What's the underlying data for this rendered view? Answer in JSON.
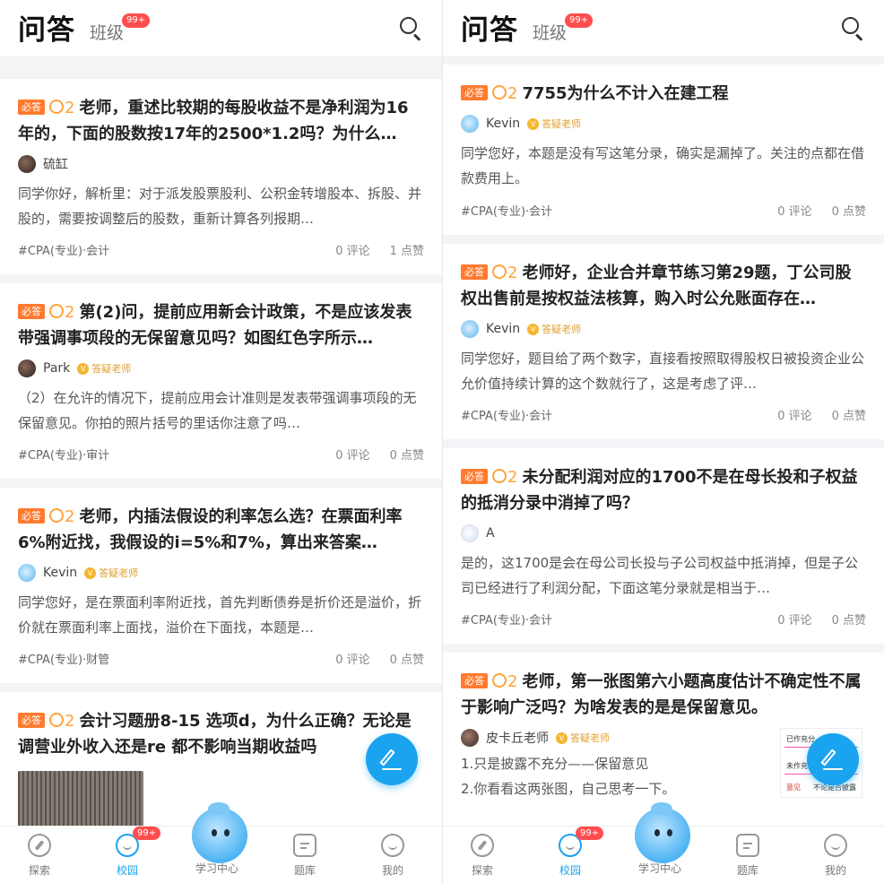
{
  "panes": [
    {
      "header": {
        "title": "问答",
        "subtitle": "班级",
        "badge": "99+"
      },
      "cards": [
        {
          "tag": "必答",
          "coins": "2",
          "question": "老师，重述比较期的每股收益不是净利润为16年的，下面的股数按17年的2500*1.2吗？为什么…",
          "author": "硫缸",
          "role": "",
          "answer": "同学你好，解析里：对于派发股票股利、公积金转增股本、拆股、并股的，需要按调整后的股数，重新计算各列报期…",
          "topic": "#CPA(专业)·会计",
          "comments": "0 评论",
          "likes": "1 点赞"
        },
        {
          "tag": "必答",
          "coins": "2",
          "question": "第(2)问，提前应用新会计政策，不是应该发表带强调事项段的无保留意见吗？如图红色字所示…",
          "author": "Park",
          "role": "答疑老师",
          "answer": "（2）在允许的情况下，提前应用会计准则是发表带强调事项段的无保留意见。你拍的照片括号的里话你注意了吗…",
          "topic": "#CPA(专业)·审计",
          "comments": "0 评论",
          "likes": "0 点赞"
        },
        {
          "tag": "必答",
          "coins": "2",
          "question": "老师，内插法假设的利率怎么选？在票面利率6%附近找，我假设的i=5%和7%，算出来答案…",
          "author": "Kevin",
          "role": "答疑老师",
          "answer": "同学您好，是在票面利率附近找，首先判断债券是折价还是溢价，折价就在票面利率上面找，溢价在下面找，本题是…",
          "topic": "#CPA(专业)·财管",
          "comments": "0 评论",
          "likes": "0 点赞"
        },
        {
          "tag": "必答",
          "coins": "2",
          "question": "会计习题册8-15 选项d，为什么正确？无论是调营业外收入还是re 都不影响当期收益吗"
        }
      ],
      "tabs": [
        "探索",
        "校园",
        "学习中心",
        "题库",
        "我的"
      ],
      "tab_badge": "99+"
    },
    {
      "header": {
        "title": "问答",
        "subtitle": "班级",
        "badge": "99+"
      },
      "cards": [
        {
          "tag": "必答",
          "coins": "2",
          "question": "7755为什么不计入在建工程",
          "author": "Kevin",
          "role": "答疑老师",
          "answer": "同学您好，本题是没有写这笔分录，确实是漏掉了。关注的点都在借款费用上。",
          "topic": "#CPA(专业)·会计",
          "comments": "0 评论",
          "likes": "0 点赞"
        },
        {
          "tag": "必答",
          "coins": "2",
          "question": "老师好，企业合并章节练习第29题，丁公司股权出售前是按权益法核算，购入时公允账面存在…",
          "author": "Kevin",
          "role": "答疑老师",
          "answer": "同学您好，题目给了两个数字，直接看按照取得股权日被投资企业公允价值持续计算的这个数就行了，这是考虑了评…",
          "topic": "#CPA(专业)·会计",
          "comments": "0 评论",
          "likes": "0 点赞"
        },
        {
          "tag": "必答",
          "coins": "2",
          "question": "未分配利润对应的1700不是在母长投和子权益的抵消分录中消掉了吗？",
          "author": "A",
          "role": "",
          "answer": "是的，这1700是会在母公司长投与子公司权益中抵消掉，但是子公司已经进行了利润分配，下面这笔分录就是相当于…",
          "topic": "#CPA(专业)·会计",
          "comments": "0 评论",
          "likes": "0 点赞"
        },
        {
          "tag": "必答",
          "coins": "2",
          "question": "老师，第一张图第六小题高度估计不确定性不属于影响广泛吗？为啥发表的是是保留意见。",
          "author": "皮卡丘老师",
          "role": "答疑老师",
          "answer_lines": [
            "1.只是披露不充分——保留意见",
            "2.你看看这两张图，自己思考一下。"
          ],
          "side_text": [
            "已作充分",
            "未作充分",
            "意见",
            "不论是否披露"
          ]
        }
      ],
      "tabs": [
        "探索",
        "校园",
        "学习中心",
        "题库",
        "我的"
      ],
      "tab_badge": "99+"
    }
  ]
}
